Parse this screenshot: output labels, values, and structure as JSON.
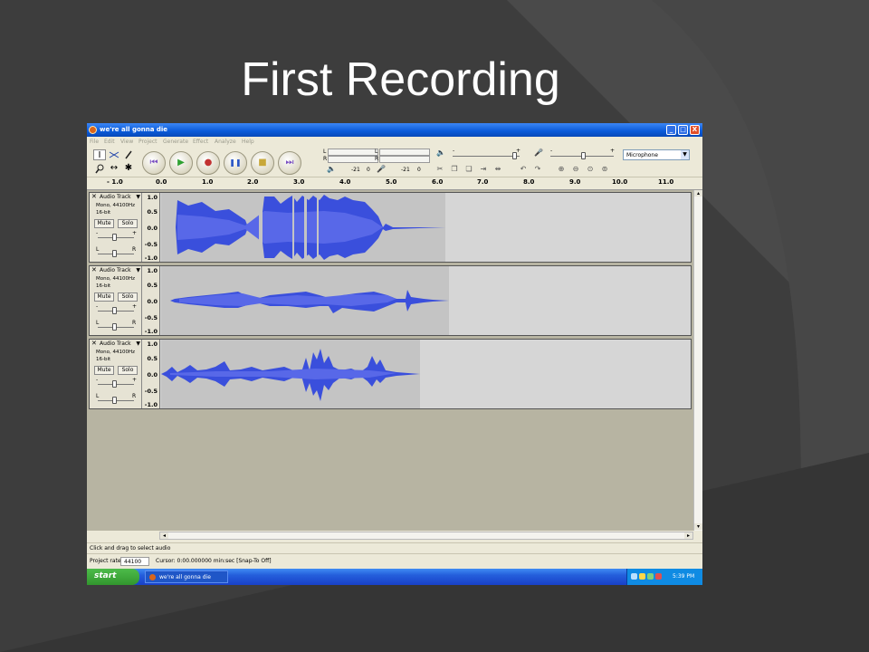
{
  "slide": {
    "title": "First Recording",
    "colors": {
      "background": "#3d3d3d",
      "title": "#ffffff"
    }
  },
  "window": {
    "title": "we're all gonna die",
    "buttons": {
      "minimize": "_",
      "maximize": "□",
      "close": "X"
    }
  },
  "menu": [
    "File",
    "Edit",
    "View",
    "Project",
    "Generate",
    "Effect",
    "Analyze",
    "Help"
  ],
  "tools": {
    "selection": "I",
    "envelope": "envelope-tool-icon",
    "draw": "draw-tool-icon",
    "zoom": "zoom-tool-icon",
    "timeshift": "↔",
    "multi": "✱"
  },
  "transport": {
    "skip_start": "⏮",
    "play": "▶",
    "record": "●",
    "pause": "❚❚",
    "stop": "■",
    "skip_end": "⏭"
  },
  "meters": {
    "playback_left": "L",
    "playback_right": "R",
    "record_left": "L",
    "record_right": "R",
    "scale_left": "-21",
    "scale_left_end": "0",
    "scale_right": "-21",
    "scale_right_end": "0"
  },
  "mixer": {
    "volume_minus": "-",
    "volume_plus": "+",
    "input_minus": "-",
    "input_plus": "+",
    "input_source": "Microphone"
  },
  "ruler": [
    "- 1.0",
    "0.0",
    "1.0",
    "2.0",
    "3.0",
    "4.0",
    "5.0",
    "6.0",
    "7.0",
    "8.0",
    "9.0",
    "10.0",
    "11.0"
  ],
  "tracks": [
    {
      "name": "Audio Track",
      "info1": "Mono, 44100Hz",
      "info2": "16-bit",
      "mute": "Mute",
      "solo": "Solo",
      "gain_minus": "-",
      "gain_plus": "+",
      "pan_left": "L",
      "pan_right": "R",
      "scale": [
        "1.0",
        "0.5",
        "0.0",
        "-0.5",
        "-1.0"
      ]
    },
    {
      "name": "Audio Track",
      "info1": "Mono, 44100Hz",
      "info2": "16-bit",
      "mute": "Mute",
      "solo": "Solo",
      "gain_minus": "-",
      "gain_plus": "+",
      "pan_left": "L",
      "pan_right": "R",
      "scale": [
        "1.0",
        "0.5",
        "0.0",
        "-0.5",
        "-1.0"
      ]
    },
    {
      "name": "Audio Track",
      "info1": "Mono, 44100Hz",
      "info2": "16-bit",
      "mute": "Mute",
      "solo": "Solo",
      "gain_minus": "-",
      "gain_plus": "+",
      "pan_left": "L",
      "pan_right": "R",
      "scale": [
        "1.0",
        "0.5",
        "0.0",
        "-0.5",
        "-1.0"
      ]
    }
  ],
  "status": {
    "hint": "Click and drag to select audio",
    "project_rate_label": "Project rate:",
    "project_rate": "44100",
    "cursor": "Cursor: 0:00.000000 min:sec   [Snap-To Off]"
  },
  "taskbar": {
    "start": "start",
    "task": "we're all gonna die",
    "clock": "5:39 PM"
  }
}
